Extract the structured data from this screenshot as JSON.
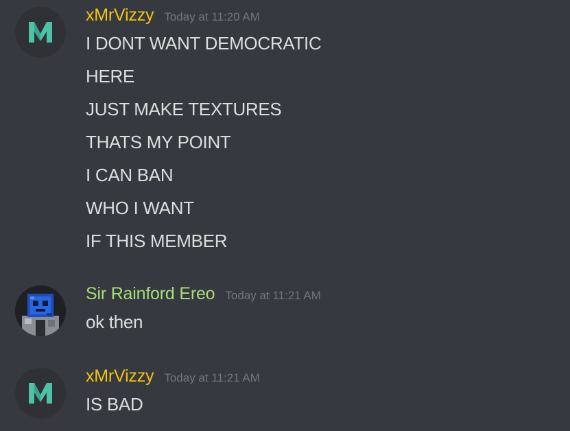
{
  "colors": {
    "background": "#36393f",
    "text": "#dcddde",
    "timestamp": "#72767d",
    "user_xmrvizzy": "#f1c40f",
    "user_sir_rainford": "#a9dc76",
    "avatar_v_color": "#4fc1a6"
  },
  "messages": [
    {
      "username": "xMrVizzy",
      "timestamp": "Today at 11:20 AM",
      "avatar_icon": "teal-v-logo",
      "lines": [
        "I DONT WANT DEMOCRATIC",
        "HERE",
        "JUST MAKE TEXTURES",
        "THATS MY POINT",
        "I CAN BAN",
        "WHO I WANT",
        "IF THIS MEMBER"
      ]
    },
    {
      "username": "Sir Rainford Ereo",
      "timestamp": "Today at 11:21 AM",
      "avatar_icon": "pixel-character-avatar",
      "lines": [
        "ok then"
      ]
    },
    {
      "username": "xMrVizzy",
      "timestamp": "Today at 11:21 AM",
      "avatar_icon": "teal-v-logo",
      "lines": [
        "IS BAD"
      ]
    }
  ]
}
